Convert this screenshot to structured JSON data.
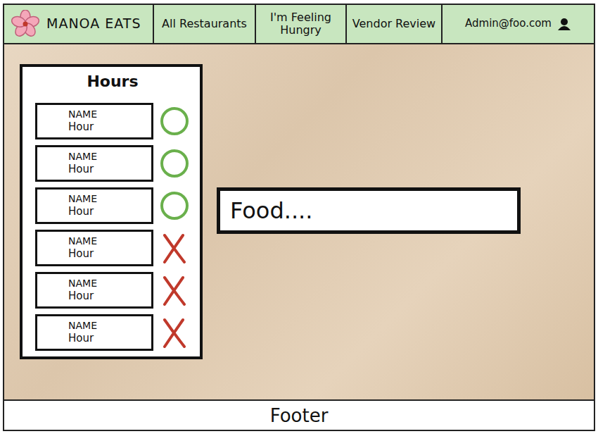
{
  "nav": {
    "logo": "MANOA EATS",
    "links": [
      {
        "label": "All Restaurants"
      },
      {
        "label": "I'm Feeling Hungry"
      },
      {
        "label": "Vendor Review"
      }
    ],
    "user": "Admin@foo.com"
  },
  "hours": {
    "title": "Hours",
    "items": [
      {
        "name": "NAME",
        "hour": "Hour",
        "open": true
      },
      {
        "name": "NAME",
        "hour": "Hour",
        "open": true
      },
      {
        "name": "NAME",
        "hour": "Hour",
        "open": true
      },
      {
        "name": "NAME",
        "hour": "Hour",
        "open": false
      },
      {
        "name": "NAME",
        "hour": "Hour",
        "open": false
      },
      {
        "name": "NAME",
        "hour": "Hour",
        "open": false
      }
    ]
  },
  "search": {
    "placeholder": "Food...."
  },
  "footer": "Footer"
}
